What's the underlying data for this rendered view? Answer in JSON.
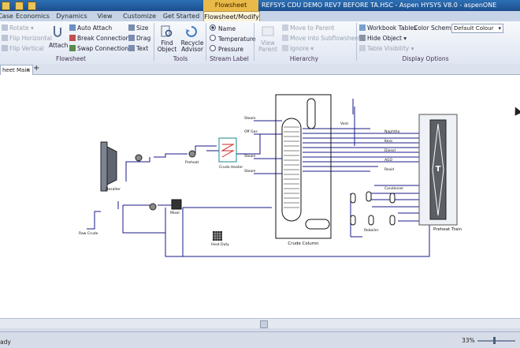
{
  "titlebar": {
    "context_tab": "Flowsheet",
    "title": "REFSYS CDU DEMO REV7 BEFORE TA.HSC - Aspen HYSYS V8.0 - aspenONE"
  },
  "menu_tabs": [
    {
      "label": "Case"
    },
    {
      "label": "Economics"
    },
    {
      "label": "Dynamics"
    },
    {
      "label": "View"
    },
    {
      "label": "Customize"
    },
    {
      "label": "Get Started"
    },
    {
      "label": "Flowsheet/Modify"
    }
  ],
  "ribbon": {
    "flowsheet": {
      "rotate": "Rotate",
      "flip_h": "Flip Horizontal",
      "flip_v": "Flip Vertical",
      "attach": "Attach",
      "auto_attach": "Auto Attach",
      "break_conn": "Break Connection",
      "swap_conn": "Swap Connection",
      "size": "Size",
      "drag": "Drag",
      "text": "Text",
      "label": "Flowsheet"
    },
    "tools": {
      "find_object": "Find Object",
      "recycle_advisor": "Recycle Advisor",
      "label": "Tools"
    },
    "stream_label": {
      "name": "Name",
      "temperature": "Temperature",
      "pressure": "Pressure",
      "label": "Stream Label"
    },
    "hierarchy": {
      "view_parent": "View Parent",
      "move_to_parent": "Move to Parent",
      "move_into_sub": "Move into Subflowsheet",
      "ignore": "Ignore",
      "label": "Hierarchy"
    },
    "display": {
      "workbook_tables": "Workbook Tables",
      "color_scheme": "Color Scheme",
      "color_value": "Default Colour",
      "hide_object": "Hide Object",
      "table_visibility": "Table Visibility",
      "label": "Display Options"
    }
  },
  "doc_tab": {
    "label": "heet Main",
    "close": "×",
    "add": "+"
  },
  "flowsheet": {
    "crude_column": "Crude Column",
    "preheat_train": "Preheat Train",
    "preheat_symbol": "T",
    "labels": {
      "raw_crude": "Raw Crude",
      "desalter": "Desalter",
      "preheat": "Preheat",
      "crude_heater": "Crude Heater",
      "mixer": "Mixer",
      "naphtha": "Naphtha",
      "kero": "Kero",
      "diesel": "Diesel",
      "ago": "AGO",
      "resid": "Resid",
      "vent": "Vent",
      "off_gas": "Off Gas",
      "steam": "Steam",
      "condenser": "Condenser",
      "reboiler": "Reboiler",
      "heat_duty": "Heat Duty"
    }
  },
  "status": {
    "text": "ady",
    "zoom": "33%"
  }
}
